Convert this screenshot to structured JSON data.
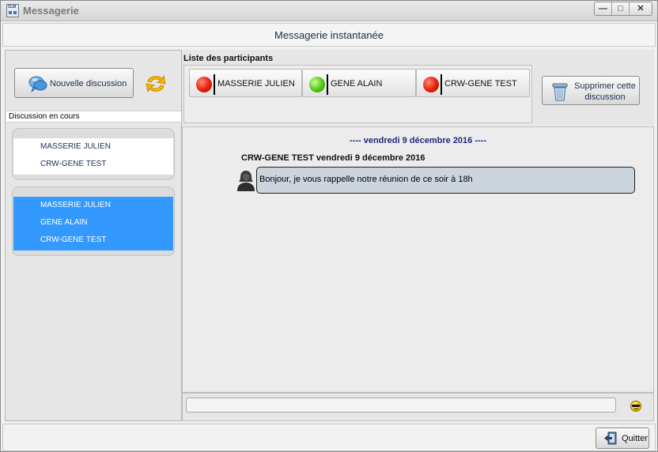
{
  "window": {
    "title": "Messagerie",
    "app_icon_label": "CLM",
    "controls": {
      "minimize": "—",
      "maximize": "□",
      "close": "✕"
    }
  },
  "header": {
    "title": "Messagerie instantanée"
  },
  "left_panel": {
    "new_discussion_label": "Nouvelle discussion",
    "section_label": "Discussion en cours",
    "discussions": [
      {
        "participants": [
          "MASSERIE JULIEN",
          "CRW-GENE TEST"
        ],
        "selected": false
      },
      {
        "participants": [
          "MASSERIE JULIEN",
          "GENE ALAIN",
          "CRW-GENE TEST"
        ],
        "selected": true
      }
    ]
  },
  "participants": {
    "label": "Liste des participants",
    "items": [
      {
        "name": "MASSERIE JULIEN",
        "status": "red"
      },
      {
        "name": "GENE ALAIN",
        "status": "green"
      },
      {
        "name": "CRW-GENE TEST",
        "status": "red"
      }
    ]
  },
  "delete_button_label": "Supprimer cette discussion",
  "chat": {
    "date_separator": "---- vendredi 9 décembre 2016 ----",
    "messages": [
      {
        "header": "CRW-GENE TEST  vendredi 9 décembre 2016",
        "text": "Bonjour, je vous rappelle notre réunion de ce soir à 18h"
      }
    ]
  },
  "input": {
    "value": "",
    "placeholder": ""
  },
  "footer": {
    "quit_label": "Quitter"
  },
  "colors": {
    "selected": "#3399ff",
    "bubble": "#ccd5de",
    "date_text": "#1f2a7a"
  }
}
